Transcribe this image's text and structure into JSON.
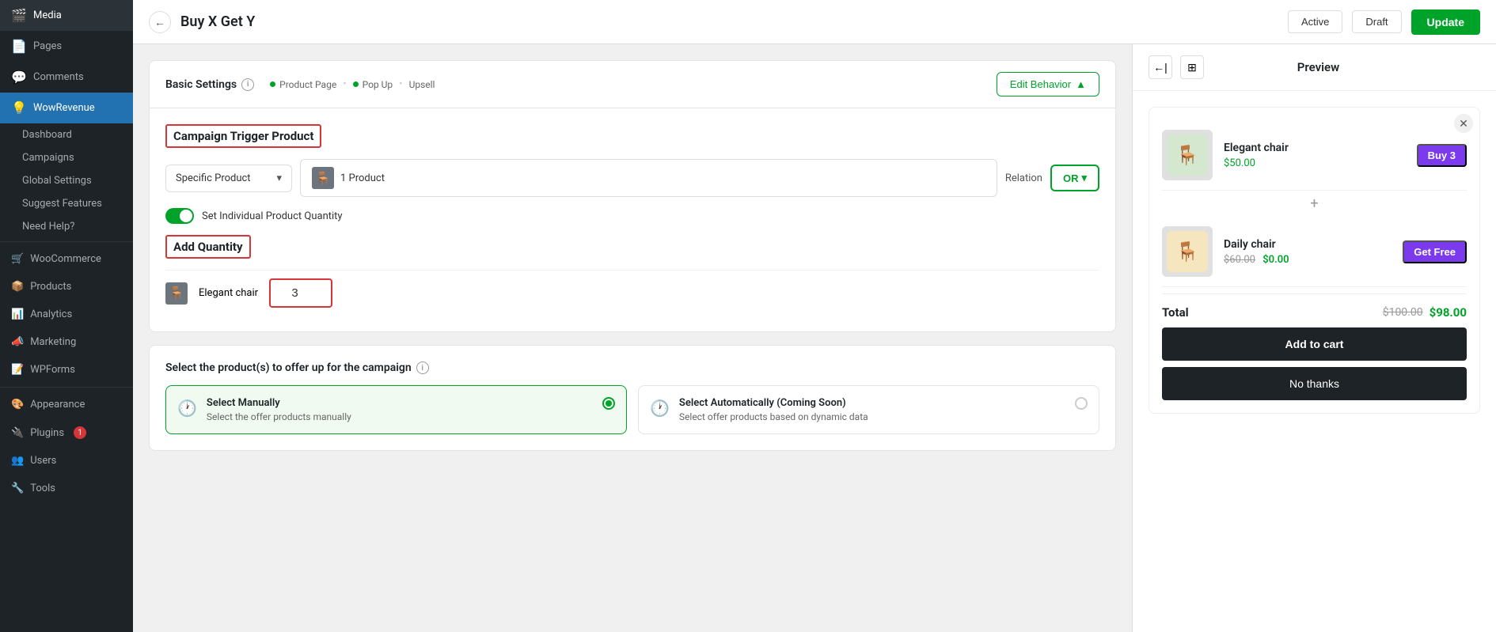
{
  "sidebar": {
    "items": [
      {
        "id": "media",
        "label": "Media",
        "icon": "🎬"
      },
      {
        "id": "pages",
        "label": "Pages",
        "icon": "📄"
      },
      {
        "id": "comments",
        "label": "Comments",
        "icon": "💬"
      },
      {
        "id": "wowrevenue",
        "label": "WowRevenue",
        "icon": "💡",
        "active": true
      },
      {
        "id": "dashboard",
        "label": "Dashboard"
      },
      {
        "id": "campaigns",
        "label": "Campaigns"
      },
      {
        "id": "global-settings",
        "label": "Global Settings"
      },
      {
        "id": "suggest-features",
        "label": "Suggest Features"
      },
      {
        "id": "need-help",
        "label": "Need Help?"
      },
      {
        "id": "woocommerce",
        "label": "WooCommerce",
        "icon": "🛒"
      },
      {
        "id": "products",
        "label": "Products",
        "icon": "📦"
      },
      {
        "id": "analytics",
        "label": "Analytics",
        "icon": "📊"
      },
      {
        "id": "marketing",
        "label": "Marketing",
        "icon": "📣"
      },
      {
        "id": "wpforms",
        "label": "WPForms",
        "icon": "📝"
      },
      {
        "id": "appearance",
        "label": "Appearance",
        "icon": "🎨"
      },
      {
        "id": "plugins",
        "label": "Plugins",
        "icon": "🔌",
        "badge": "1"
      },
      {
        "id": "users",
        "label": "Users",
        "icon": "👥"
      },
      {
        "id": "tools",
        "label": "Tools",
        "icon": "🔧"
      }
    ]
  },
  "header": {
    "back_label": "←",
    "title": "Buy X Get Y",
    "active_label": "Active",
    "draft_label": "Draft",
    "update_label": "Update"
  },
  "basic_settings": {
    "title": "Basic Settings",
    "tabs": [
      {
        "label": "Product Page"
      },
      {
        "label": "Pop Up"
      },
      {
        "label": "Upsell"
      }
    ],
    "edit_behavior_label": "Edit Behavior"
  },
  "campaign_trigger": {
    "title": "Campaign Trigger Product",
    "dropdown_label": "Specific Product",
    "product_input_label": "1 Product",
    "relation_label": "Relation",
    "or_label": "OR",
    "toggle_label": "Set Individual Product Quantity"
  },
  "add_quantity": {
    "title": "Add Quantity",
    "items": [
      {
        "name": "Elegant chair",
        "quantity": "3"
      }
    ]
  },
  "select_products": {
    "title": "Select the product(s) to offer up for the campaign",
    "options": [
      {
        "id": "manual",
        "title": "Select Manually",
        "description": "Select the offer products manually",
        "active": true
      },
      {
        "id": "auto",
        "title": "Select Automatically (Coming Soon)",
        "description": "Select offer products based on dynamic data",
        "active": false
      }
    ]
  },
  "preview": {
    "title": "Preview",
    "products": [
      {
        "name": "Elegant chair",
        "price": "$50.00",
        "badge": "Buy 3",
        "badge_color": "purple",
        "emoji": "🪑"
      },
      {
        "name": "Daily chair",
        "price_old": "$60.00",
        "price_new": "$0.00",
        "badge": "Get Free",
        "badge_color": "purple",
        "emoji": "🪑"
      }
    ],
    "total_label": "Total",
    "total_old": "$100.00",
    "total_new": "$98.00",
    "add_to_cart_label": "Add to cart",
    "no_thanks_label": "No thanks",
    "plus_symbol": "+"
  }
}
